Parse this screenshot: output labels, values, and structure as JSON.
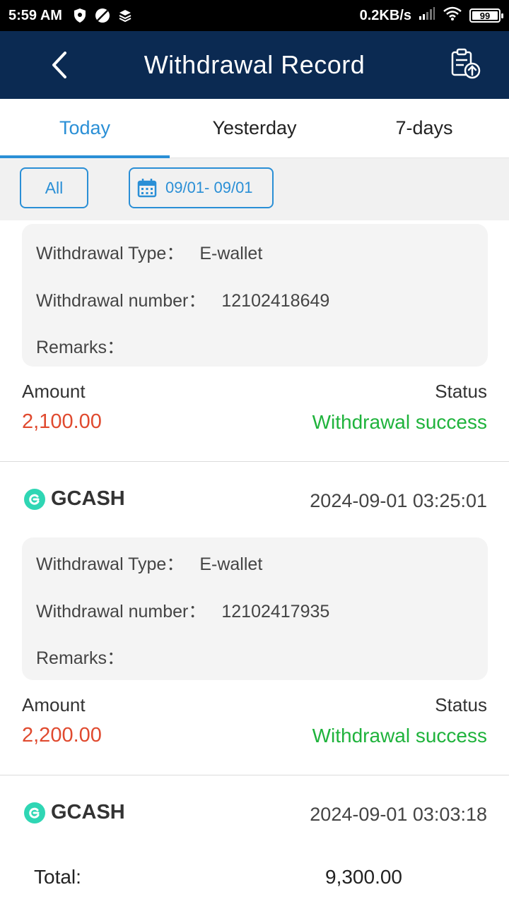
{
  "status_bar": {
    "time": "5:59 AM",
    "network_speed": "0.2KB/s",
    "battery": "99",
    "icons": [
      "shield-icon",
      "no-sim-icon",
      "layers-icon",
      "signal-icon",
      "wifi-icon",
      "battery-icon"
    ]
  },
  "header": {
    "title": "Withdrawal Record",
    "back_icon": "chevron-left-icon",
    "export_icon": "clipboard-upload-icon"
  },
  "tabs": [
    {
      "label": "Today",
      "active": true
    },
    {
      "label": "Yesterday",
      "active": false
    },
    {
      "label": "7-days",
      "active": false
    }
  ],
  "filters": {
    "type_label": "All",
    "date_range": "09/01- 09/01",
    "calendar_icon": "calendar-icon"
  },
  "labels": {
    "withdrawal_type": "Withdrawal Type：",
    "withdrawal_number": "Withdrawal number：",
    "remarks": "Remarks：",
    "amount": "Amount",
    "status": "Status"
  },
  "records": [
    {
      "type": "E-wallet",
      "number": "12102418649",
      "remarks": "",
      "amount": "2,100.00",
      "status": "Withdrawal success"
    },
    {
      "provider": "GCASH",
      "datetime": "2024-09-01 03:25:01",
      "type": "E-wallet",
      "number": "12102417935",
      "remarks": "",
      "amount": "2,200.00",
      "status": "Withdrawal success"
    },
    {
      "provider": "GCASH",
      "datetime": "2024-09-01 03:03:18"
    }
  ],
  "footer": {
    "total_label": "Total:",
    "total_value": "9,300.00"
  },
  "colors": {
    "header_bg": "#0b2a52",
    "accent": "#2a8fd6",
    "amount": "#e04a2f",
    "success": "#1fb33c",
    "gcash": "#2fd6b4"
  }
}
